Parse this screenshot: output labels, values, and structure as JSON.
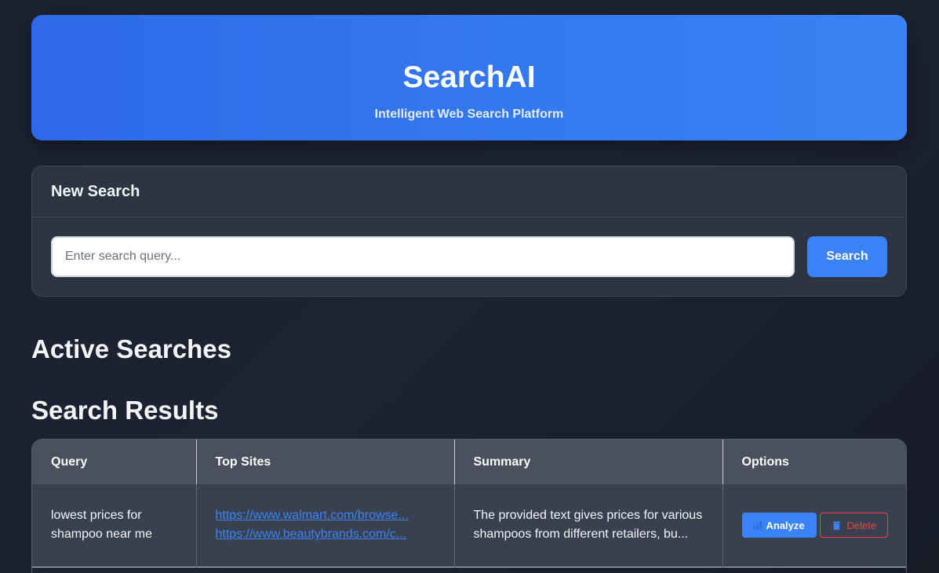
{
  "hero": {
    "title": "SearchAI",
    "subtitle": "Intelligent Web Search Platform"
  },
  "new_search": {
    "title": "New Search",
    "placeholder": "Enter search query...",
    "button_label": "Search"
  },
  "sections": {
    "active_searches": "Active Searches",
    "search_results": "Search Results"
  },
  "results_table": {
    "columns": [
      "Query",
      "Top Sites",
      "Summary",
      "Options"
    ],
    "rows": [
      {
        "query": "lowest prices for shampoo near me",
        "sites": [
          "https://www.walmart.com/browse...",
          "https://www.beautybrands.com/c..."
        ],
        "summary": "The provided text gives prices for various shampoos from different retailers, bu...",
        "analyze_label": "Analyze",
        "delete_label": "Delete"
      }
    ]
  },
  "icons": {
    "analyze": "chart-icon",
    "delete": "trash-icon"
  },
  "colors": {
    "accent": "#3b82f6",
    "danger": "#ef4444",
    "background": "#1b2130"
  }
}
